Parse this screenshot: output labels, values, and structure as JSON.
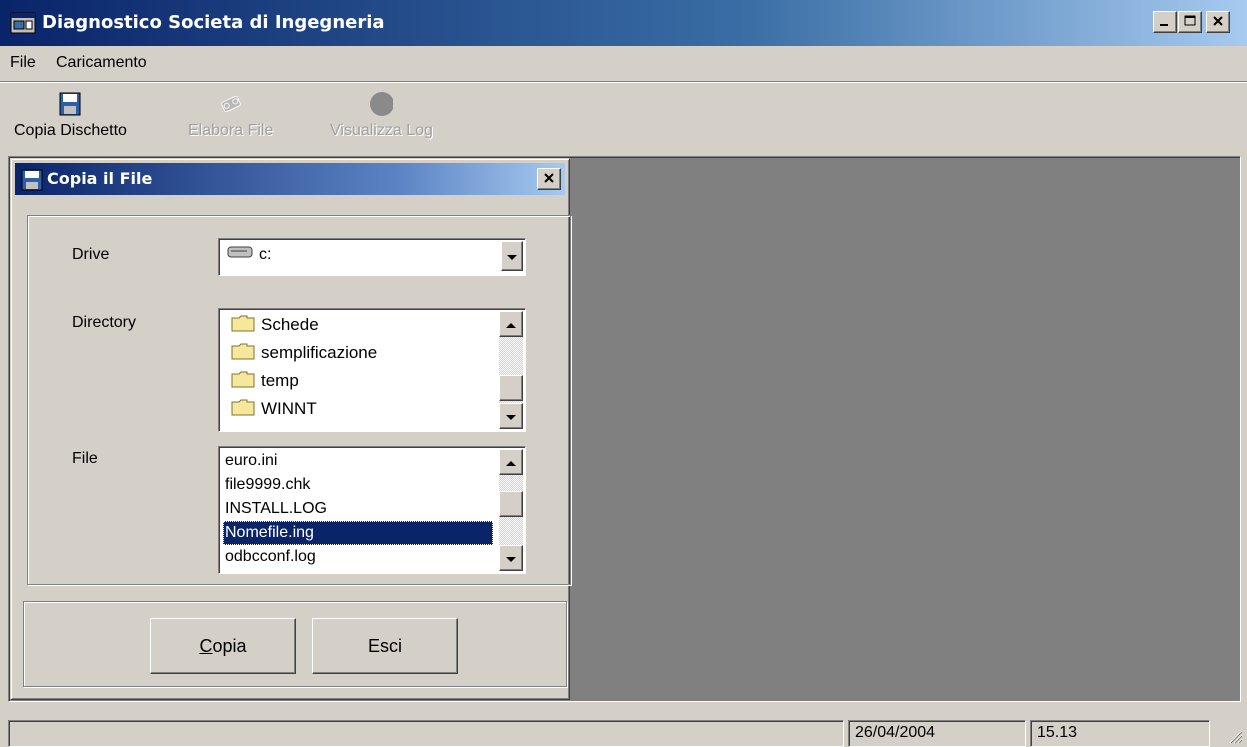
{
  "window": {
    "title": "Diagnostico Societa di Ingegneria"
  },
  "menu": {
    "items": [
      "File",
      "Caricamento"
    ]
  },
  "toolbar": {
    "copy_label": "Copia Dischetto",
    "process_label": "Elabora File",
    "log_label": "Visualizza Log"
  },
  "dialog": {
    "title": "Copia il File",
    "drive_label": "Drive",
    "drive_value": "c:",
    "directory_label": "Directory",
    "directories": [
      "Schede",
      "semplificazione",
      "temp",
      "WINNT"
    ],
    "file_label": "File",
    "files": [
      "euro.ini",
      "file9999.chk",
      "INSTALL.LOG",
      "Nomefile.ing",
      "odbcconf.log"
    ],
    "selected_file": "Nomefile.ing",
    "copy_button": "Copia",
    "copy_button_rest": "opia",
    "copy_button_accel": "C",
    "exit_button": "Esci"
  },
  "status": {
    "date": "26/04/2004",
    "time": "15.13"
  },
  "colors": {
    "titlebar": "#0a246a",
    "selection": "#0a246a",
    "face": "#d4d0c8",
    "mdi_background": "#808080"
  }
}
